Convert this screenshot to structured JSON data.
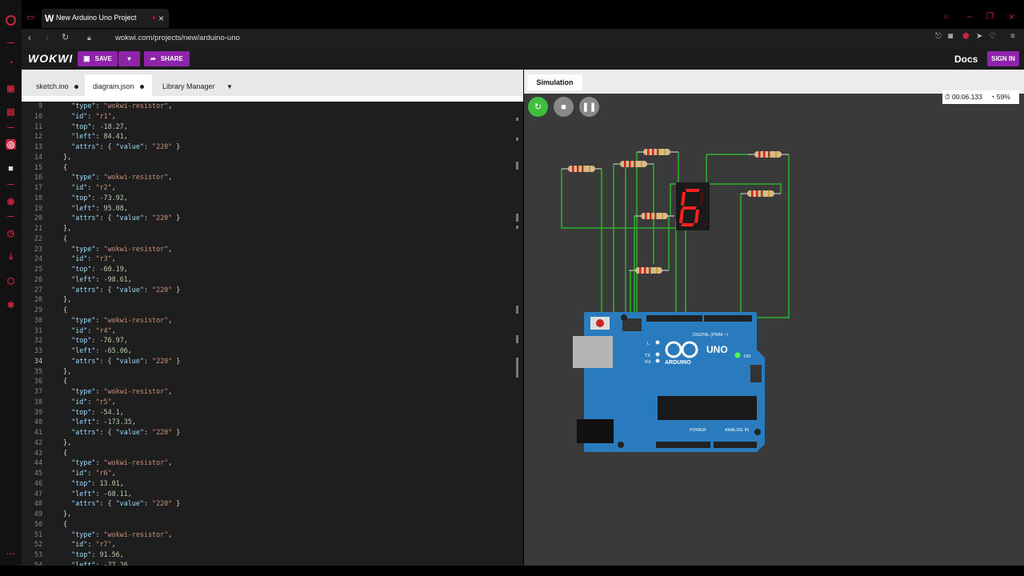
{
  "browser": {
    "tab_title": "New Arduino Uno Project",
    "url": "wokwi.com/projects/new/arduino-uno"
  },
  "app": {
    "logo": "WOKWI",
    "save_label": "SAVE",
    "share_label": "SHARE",
    "docs_label": "Docs",
    "signin_label": "SIGN IN"
  },
  "editor": {
    "tabs": [
      "sketch.ino",
      "diagram.json",
      "Library Manager"
    ],
    "active_tab": "diagram.json",
    "cursor_line": 34
  },
  "code_lines": [
    {
      "n": 9,
      "code": "    \"type\": \"wokwi-resistor\","
    },
    {
      "n": 10,
      "code": "    \"id\": \"r1\","
    },
    {
      "n": 11,
      "code": "    \"top\": -18.27,"
    },
    {
      "n": 12,
      "code": "    \"left\": 84.41,"
    },
    {
      "n": 13,
      "code": "    \"attrs\": { \"value\": \"220\" }"
    },
    {
      "n": 14,
      "code": "  },"
    },
    {
      "n": 15,
      "code": "  {"
    },
    {
      "n": 16,
      "code": "    \"type\": \"wokwi-resistor\","
    },
    {
      "n": 17,
      "code": "    \"id\": \"r2\","
    },
    {
      "n": 18,
      "code": "    \"top\": -73.92,"
    },
    {
      "n": 19,
      "code": "    \"left\": 95.08,"
    },
    {
      "n": 20,
      "code": "    \"attrs\": { \"value\": \"220\" }"
    },
    {
      "n": 21,
      "code": "  },"
    },
    {
      "n": 22,
      "code": "  {"
    },
    {
      "n": 23,
      "code": "    \"type\": \"wokwi-resistor\","
    },
    {
      "n": 24,
      "code": "    \"id\": \"r3\","
    },
    {
      "n": 25,
      "code": "    \"top\": -60.19,"
    },
    {
      "n": 26,
      "code": "    \"left\": -98.61,"
    },
    {
      "n": 27,
      "code": "    \"attrs\": { \"value\": \"220\" }"
    },
    {
      "n": 28,
      "code": "  },"
    },
    {
      "n": 29,
      "code": "  {"
    },
    {
      "n": 30,
      "code": "    \"type\": \"wokwi-resistor\","
    },
    {
      "n": 31,
      "code": "    \"id\": \"r4\","
    },
    {
      "n": 32,
      "code": "    \"top\": -76.97,"
    },
    {
      "n": 33,
      "code": "    \"left\": -65.06,"
    },
    {
      "n": 34,
      "code": "    \"attrs\": { \"value\": \"220\" }"
    },
    {
      "n": 35,
      "code": "  },"
    },
    {
      "n": 36,
      "code": "  {"
    },
    {
      "n": 37,
      "code": "    \"type\": \"wokwi-resistor\","
    },
    {
      "n": 38,
      "code": "    \"id\": \"r5\","
    },
    {
      "n": 39,
      "code": "    \"top\": -54.1,"
    },
    {
      "n": 40,
      "code": "    \"left\": -173.35,"
    },
    {
      "n": 41,
      "code": "    \"attrs\": { \"value\": \"220\" }"
    },
    {
      "n": 42,
      "code": "  },"
    },
    {
      "n": 43,
      "code": "  {"
    },
    {
      "n": 44,
      "code": "    \"type\": \"wokwi-resistor\","
    },
    {
      "n": 45,
      "code": "    \"id\": \"r6\","
    },
    {
      "n": 46,
      "code": "    \"top\": 13.01,"
    },
    {
      "n": 47,
      "code": "    \"left\": -68.11,"
    },
    {
      "n": 48,
      "code": "    \"attrs\": { \"value\": \"220\" }"
    },
    {
      "n": 49,
      "code": "  },"
    },
    {
      "n": 50,
      "code": "  {"
    },
    {
      "n": 51,
      "code": "    \"type\": \"wokwi-resistor\","
    },
    {
      "n": 52,
      "code": "    \"id\": \"r7\","
    },
    {
      "n": 53,
      "code": "    \"top\": 91.56,"
    },
    {
      "n": 54,
      "code": "    \"left\": -77.26,"
    }
  ],
  "simulation": {
    "tab_label": "Simulation",
    "time": "00:06.133",
    "speed": "59%",
    "display_digit": "6",
    "board": {
      "model": "UNO",
      "brand": "ARDUINO",
      "digital_label": "DIGITAL (PWM ~)",
      "power_label": "POWER",
      "analog_label": "ANALOG IN",
      "on_label": "ON",
      "led_l": "L",
      "led_tx": "TX",
      "led_rx": "RX"
    }
  },
  "colors": {
    "accent": "#8e24aa",
    "wire": "#2db32d",
    "board": "#2a7bbd",
    "segment_on": "#ff2020",
    "sidebar_icon": "#c8233d"
  }
}
